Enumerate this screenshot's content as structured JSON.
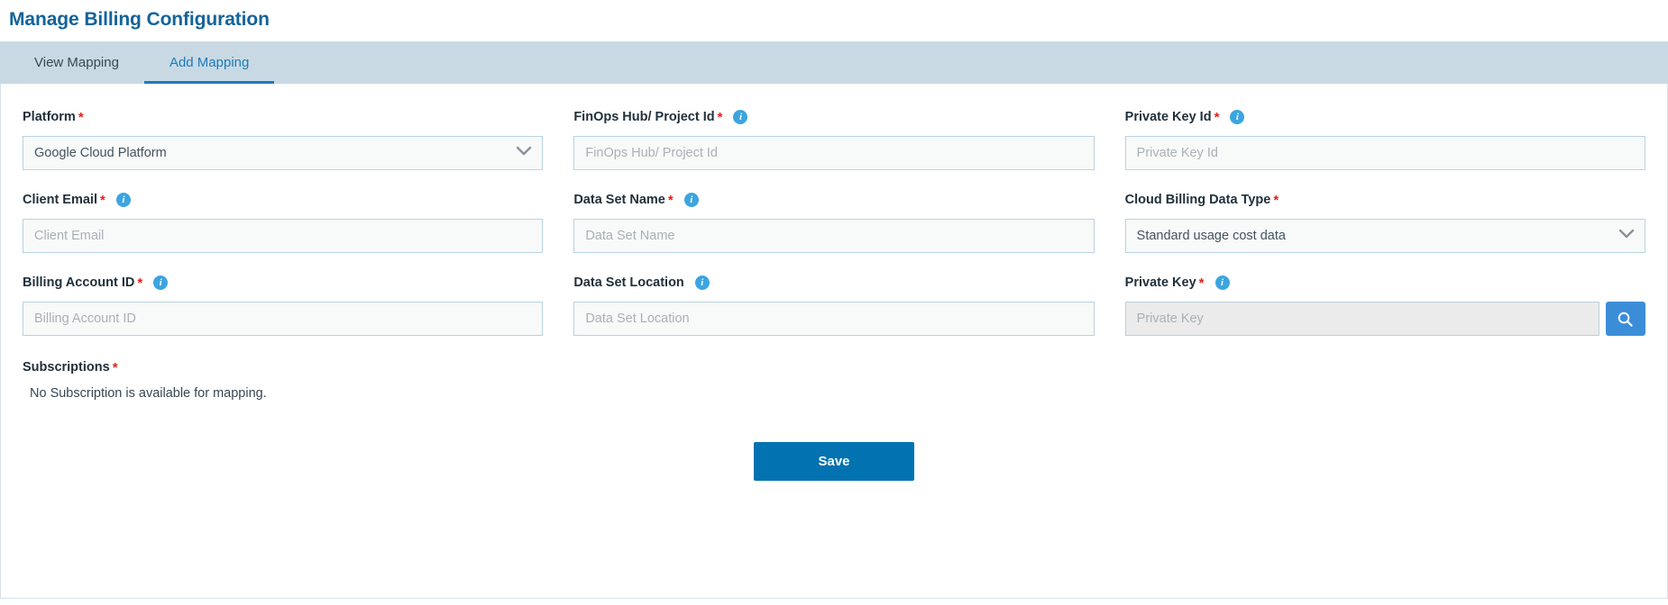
{
  "page": {
    "title": "Manage Billing Configuration"
  },
  "tabs": [
    {
      "label": "View Mapping",
      "active": false
    },
    {
      "label": "Add Mapping",
      "active": true
    }
  ],
  "form": {
    "fields": [
      {
        "name": "platform",
        "label": "Platform",
        "required": true,
        "info": false,
        "type": "select",
        "value": "Google Cloud Platform"
      },
      {
        "name": "finops-hub-project-id",
        "label": "FinOps Hub/ Project Id",
        "required": true,
        "info": true,
        "type": "text",
        "value": "",
        "placeholder": "FinOps Hub/ Project Id"
      },
      {
        "name": "private-key-id",
        "label": "Private Key Id",
        "required": true,
        "info": true,
        "type": "text",
        "value": "",
        "placeholder": "Private Key Id"
      },
      {
        "name": "client-email",
        "label": "Client Email",
        "required": true,
        "info": true,
        "type": "text",
        "value": "",
        "placeholder": "Client Email"
      },
      {
        "name": "data-set-name",
        "label": "Data Set Name",
        "required": true,
        "info": true,
        "type": "text",
        "value": "",
        "placeholder": "Data Set Name"
      },
      {
        "name": "cloud-billing-data-type",
        "label": "Cloud Billing Data Type",
        "required": true,
        "info": false,
        "type": "select",
        "value": "Standard usage cost data"
      },
      {
        "name": "billing-account-id",
        "label": "Billing Account ID",
        "required": true,
        "info": true,
        "type": "text",
        "value": "",
        "placeholder": "Billing Account ID"
      },
      {
        "name": "data-set-location",
        "label": "Data Set Location",
        "required": false,
        "info": true,
        "type": "text",
        "value": "",
        "placeholder": "Data Set Location"
      },
      {
        "name": "private-key",
        "label": "Private Key",
        "required": true,
        "info": true,
        "type": "text-with-search",
        "value": "",
        "placeholder": "Private Key",
        "readonly": true,
        "search_icon": "search-icon"
      }
    ],
    "subscriptions": {
      "label": "Subscriptions",
      "required": true,
      "message": "No Subscription is available for mapping."
    },
    "save_label": "Save"
  },
  "icons": {
    "info": "info-icon",
    "chevron_down": "chevron-down-icon",
    "search": "search-icon"
  },
  "colors": {
    "title": "#14639a",
    "tab_bar": "#c9d9e4",
    "tab_active": "#1b7cb8",
    "required_star": "#e32119",
    "info_badge": "#3ca5e0",
    "search_button": "#3c8dd8",
    "save_button": "#0273b0",
    "input_border": "#b9d2e0",
    "input_bg": "#f8f9f9",
    "readonly_bg": "#ebebeb"
  }
}
